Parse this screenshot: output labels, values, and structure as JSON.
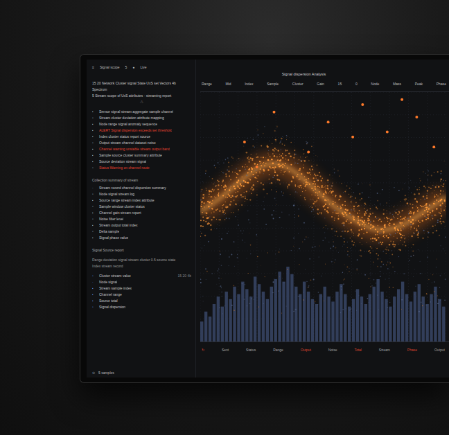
{
  "toolbar": {
    "items": [
      "≡",
      "Signal scope",
      "5",
      "●",
      "Live"
    ]
  },
  "header": {
    "lines": [
      "15  20 Network Cluster signal State UxS set Vectors 4b",
      "Spectrum",
      "5  Stream scope of UxS attributes  ·  streaming report"
    ],
    "marker": "·/\\·"
  },
  "list_primary": [
    {
      "icon": "▪",
      "text": "Sensor signal stream aggregate sample channel",
      "alert": false
    },
    {
      "icon": "▫",
      "text": "Stream cluster deviation attribute mapping",
      "alert": false
    },
    {
      "icon": "▪",
      "text": "Node range signal anomaly sequence",
      "alert": false
    },
    {
      "icon": "▪",
      "text": "ALERT  Signal dispersion exceeds set threshold",
      "alert": true
    },
    {
      "icon": "▪",
      "text": "Index cluster status  report source",
      "alert": false
    },
    {
      "icon": "▫",
      "text": "Output stream channel dataset noise",
      "alert": false
    },
    {
      "icon": "▪",
      "text": "Channel warning  unstable stream output band",
      "alert": true
    },
    {
      "icon": "▪",
      "text": "Sample source cluster summary attribute",
      "alert": false
    },
    {
      "icon": "▪",
      "text": "Source deviation stream signal",
      "alert": false
    },
    {
      "icon": "▫",
      "text": "Status  Warning  on channel route",
      "alert": true
    }
  ],
  "section_title": "Collection  summary of stream",
  "list_secondary": [
    {
      "icon": "·",
      "text": "Stream record channel dispersion summary",
      "alert": false
    },
    {
      "icon": "▫",
      "text": "Node signal stream log",
      "alert": false
    },
    {
      "icon": "▪",
      "text": "Source range stream index attribute",
      "alert": false
    },
    {
      "icon": "▫",
      "text": "Sample window cluster status",
      "alert": false
    },
    {
      "icon": "▪",
      "text": "Channel gain stream report",
      "alert": false
    },
    {
      "icon": "▫",
      "text": "Noise filter level",
      "alert": false
    },
    {
      "icon": "▪",
      "text": "Stream output total index",
      "alert": false
    },
    {
      "icon": "▫",
      "text": "Delta sample",
      "alert": false
    },
    {
      "icon": "▪",
      "text": "Signal phase value",
      "alert": false
    }
  ],
  "report": {
    "title": "Signal  Source report",
    "lines": [
      "Range deviation signal stream   cluster 0.5 source state",
      "Index stream record"
    ]
  },
  "details": [
    {
      "icon": "▫",
      "text": "Cluster stream value",
      "value": "15 20 4b"
    },
    {
      "icon": "·",
      "text": "Node signal",
      "value": ""
    },
    {
      "icon": "▪",
      "text": "Stream sample index",
      "value": ""
    },
    {
      "icon": "▪",
      "text": "Channel range",
      "value": ""
    },
    {
      "icon": "▪",
      "text": "Source total",
      "value": ""
    },
    {
      "icon": "▫",
      "text": "Signal dispersion",
      "value": ""
    }
  ],
  "status_bar": {
    "icon": "⊙",
    "text": "5 samples"
  },
  "chart": {
    "title": "Signal dispersion  Analysis",
    "columns": [
      "Range",
      "Mid",
      "Index",
      "Sample",
      "Cluster",
      "Gain",
      "15",
      "0",
      "Node",
      "Mass",
      "Peak",
      "Phase"
    ],
    "band": [
      52,
      58,
      66,
      72,
      70,
      62,
      54,
      48,
      44,
      46,
      52,
      58
    ],
    "bars": [
      8,
      12,
      10,
      15,
      18,
      14,
      20,
      17,
      22,
      19,
      24,
      21,
      18,
      26,
      23,
      20,
      17,
      22,
      25,
      28,
      24,
      30,
      27,
      22,
      19,
      24,
      20,
      17,
      15,
      19,
      22,
      18,
      16,
      20,
      23,
      19,
      14,
      17,
      21,
      18,
      15,
      19,
      22,
      25,
      20,
      17,
      14,
      18,
      21,
      24,
      19,
      16,
      20,
      23,
      18,
      15,
      19,
      22,
      17,
      14
    ],
    "highlights": [
      {
        "x": 18,
        "y": 80
      },
      {
        "x": 30,
        "y": 92
      },
      {
        "x": 52,
        "y": 88
      },
      {
        "x": 66,
        "y": 95
      },
      {
        "x": 76,
        "y": 84
      },
      {
        "x": 88,
        "y": 90
      },
      {
        "x": 95,
        "y": 78
      },
      {
        "x": 44,
        "y": 76
      },
      {
        "x": 62,
        "y": 82
      },
      {
        "x": 23,
        "y": 70
      },
      {
        "x": 82,
        "y": 97
      }
    ],
    "footer": [
      {
        "text": "↻",
        "alert": true
      },
      {
        "text": "Sent",
        "alert": false
      },
      {
        "text": "Status",
        "alert": false
      },
      {
        "text": "Range",
        "alert": false
      },
      {
        "text": "Output",
        "alert": true
      },
      {
        "text": "Noise",
        "alert": false
      },
      {
        "text": "Total",
        "alert": true
      },
      {
        "text": "Stream",
        "alert": false
      },
      {
        "text": "Phase",
        "alert": true
      },
      {
        "text": "Output",
        "alert": false
      }
    ]
  }
}
